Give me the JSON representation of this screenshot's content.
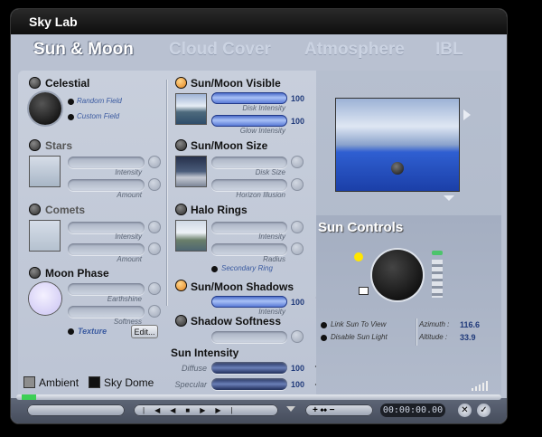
{
  "window": {
    "title": "Sky Lab"
  },
  "tabs": [
    "Sun & Moon",
    "Cloud Cover",
    "Atmosphere",
    "IBL"
  ],
  "celestial": {
    "title": "Celestial",
    "options": [
      "Random Field",
      "Custom Field"
    ]
  },
  "stars": {
    "title": "Stars",
    "labels": [
      "Intensity",
      "Amount"
    ]
  },
  "comets": {
    "title": "Comets",
    "labels": [
      "Intensity",
      "Amount"
    ]
  },
  "moon_phase": {
    "title": "Moon Phase",
    "labels": [
      "Earthshine",
      "Softness"
    ],
    "texture": "Texture",
    "edit": "Edit..."
  },
  "sun_moon_visible": {
    "title": "Sun/Moon Visible",
    "disk_label": "Disk Intensity",
    "disk_value": "100",
    "glow_label": "Glow Intensity",
    "glow_value": "100"
  },
  "sun_moon_size": {
    "title": "Sun/Moon Size",
    "labels": [
      "Disk Size",
      "Horizon Illusion"
    ]
  },
  "halo_rings": {
    "title": "Halo Rings",
    "labels": [
      "Intensity",
      "Radius"
    ],
    "secondary": "Secondary Ring"
  },
  "shadows": {
    "title": "Sun/Moon Shadows",
    "value": "100",
    "label": "Intensity"
  },
  "shadow_softness": {
    "title": "Shadow Softness"
  },
  "sun_intensity": {
    "title": "Sun Intensity",
    "diffuse_label": "Diffuse",
    "diffuse_value": "100",
    "specular_label": "Specular",
    "specular_value": "100"
  },
  "bottom_checks": {
    "ambient": "Ambient",
    "sky_dome": "Sky Dome"
  },
  "sun_controls": {
    "title": "Sun Controls",
    "link": "Link Sun To View",
    "disable": "Disable Sun Light",
    "azimuth_label": "Azimuth :",
    "azimuth_value": "116.6",
    "altitude_label": "Altitude :",
    "altitude_value": "33.9"
  },
  "timeline": {
    "time": "00:00:00.00"
  },
  "colors": {
    "accent": "#4d6fd2",
    "arrow": "#ffe600",
    "active_bullet": "#e07a12"
  }
}
